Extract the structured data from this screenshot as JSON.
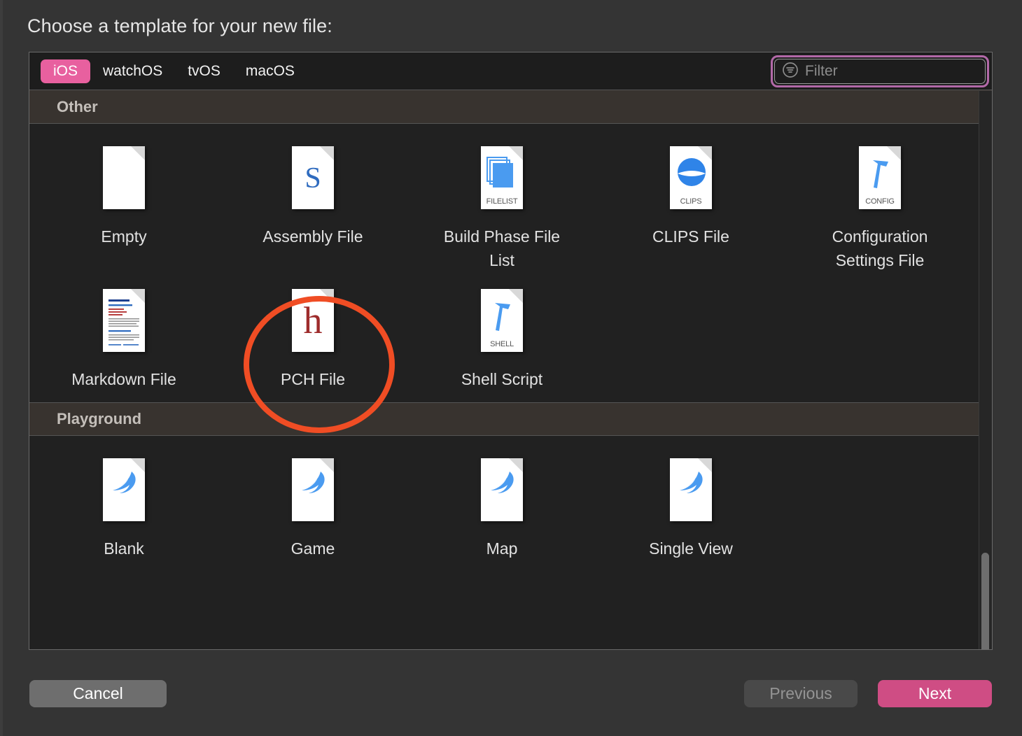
{
  "dialog": {
    "title": "Choose a template for your new file:"
  },
  "toolbar": {
    "platforms": [
      {
        "label": "iOS",
        "selected": true
      },
      {
        "label": "watchOS",
        "selected": false
      },
      {
        "label": "tvOS",
        "selected": false
      },
      {
        "label": "macOS",
        "selected": false
      }
    ],
    "filter": {
      "icon": "filter-icon",
      "value": "",
      "placeholder": "Filter",
      "focused": true,
      "focus_ring_color": "#b269a8"
    }
  },
  "sections": [
    {
      "header": "Other",
      "items": [
        {
          "label": "Empty",
          "icon": "empty-document-icon",
          "glyph": "",
          "tag": ""
        },
        {
          "label": "Assembly File",
          "icon": "assembly-file-icon",
          "glyph": "S",
          "tag": ""
        },
        {
          "label": "Build Phase File List",
          "icon": "build-phase-file-list-icon",
          "glyph": "",
          "tag": "FILELIST"
        },
        {
          "label": "CLIPS File",
          "icon": "clips-file-icon",
          "glyph": "",
          "tag": "CLIPS"
        },
        {
          "label": "Configuration Settings File",
          "icon": "configuration-settings-file-icon",
          "glyph": "",
          "tag": "CONFIG"
        },
        {
          "label": "Markdown File",
          "icon": "markdown-file-icon",
          "glyph": "",
          "tag": ""
        },
        {
          "label": "PCH File",
          "icon": "pch-file-icon",
          "glyph": "h",
          "tag": ""
        },
        {
          "label": "Shell Script",
          "icon": "shell-script-icon",
          "glyph": "",
          "tag": "SHELL"
        }
      ]
    },
    {
      "header": "Playground",
      "items": [
        {
          "label": "Blank",
          "icon": "swift-playground-icon",
          "glyph": "",
          "tag": ""
        },
        {
          "label": "Game",
          "icon": "swift-playground-icon",
          "glyph": "",
          "tag": ""
        },
        {
          "label": "Map",
          "icon": "swift-playground-icon",
          "glyph": "",
          "tag": ""
        },
        {
          "label": "Single View",
          "icon": "swift-playground-icon",
          "glyph": "",
          "tag": ""
        }
      ]
    }
  ],
  "footer": {
    "cancel_label": "Cancel",
    "previous_label": "Previous",
    "previous_enabled": false,
    "next_label": "Next",
    "next_accent_color": "#cf4d84"
  },
  "annotation": {
    "target": "PCH File",
    "shape": "ellipse",
    "color": "#f04d24"
  }
}
